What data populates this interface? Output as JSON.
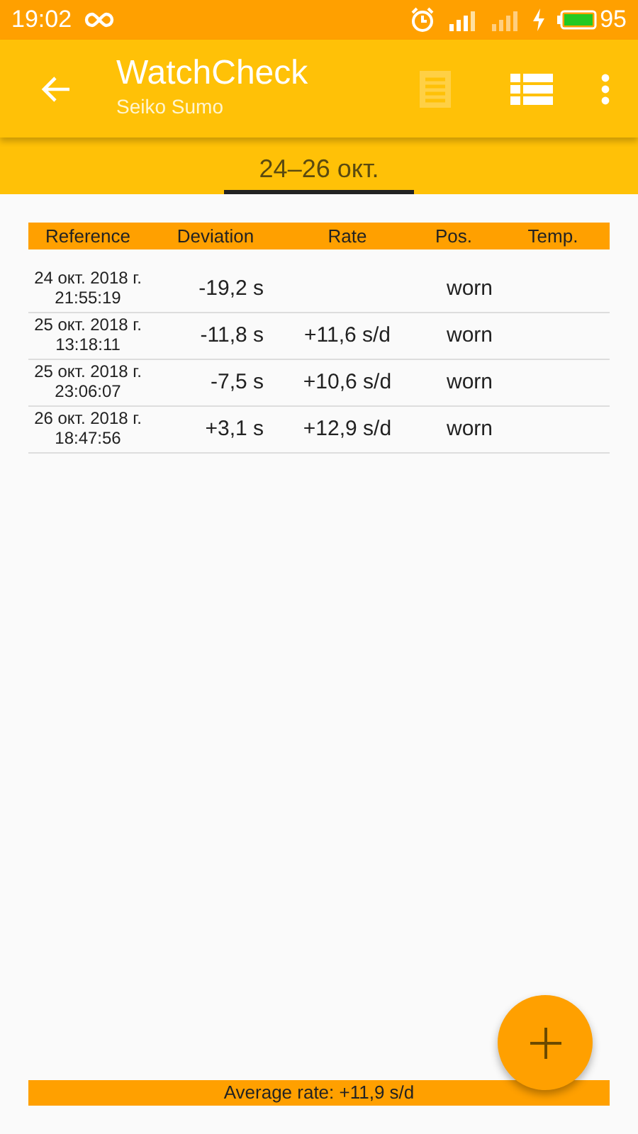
{
  "status_bar": {
    "time": "19:02",
    "battery": "95"
  },
  "toolbar": {
    "title": "WatchCheck",
    "subtitle": "Seiko Sumo",
    "actions": [
      {
        "kind": "receipt",
        "disabled": true
      },
      {
        "kind": "list",
        "disabled": false
      },
      {
        "kind": "more",
        "disabled": false
      }
    ]
  },
  "tabs": [
    {
      "label": "24–26 окт.",
      "selected": true
    }
  ],
  "table": {
    "columns": [
      "Reference",
      "Deviation",
      "Rate",
      "Pos.",
      "Temp."
    ],
    "rows": [
      {
        "date": "24 окт. 2018 г.",
        "time": "21:55:19",
        "deviation": "-19,2 s",
        "rate": "",
        "position": "worn"
      },
      {
        "date": "25 окт. 2018 г.",
        "time": "13:18:11",
        "deviation": "-11,8 s",
        "rate": "+11,6 s/d",
        "position": "worn"
      },
      {
        "date": "25 окт. 2018 г.",
        "time": "23:06:07",
        "deviation": "-7,5 s",
        "rate": "+10,6 s/d",
        "position": "worn"
      },
      {
        "date": "26 окт. 2018 г.",
        "time": "18:47:56",
        "deviation": "+3,1 s",
        "rate": "+12,9 s/d",
        "position": "worn"
      }
    ]
  },
  "footer": {
    "text": "Average rate: +11,9 s/d"
  }
}
